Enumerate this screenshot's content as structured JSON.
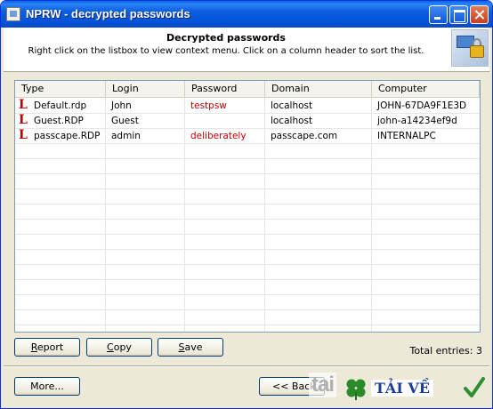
{
  "window": {
    "title": "NPRW - decrypted passwords"
  },
  "header": {
    "title": "Decrypted passwords",
    "subtitle": "Right click on the listbox to view context menu. Click on a column header to sort the list."
  },
  "table": {
    "columns": [
      "Type",
      "Login",
      "Password",
      "Domain",
      "Computer"
    ],
    "rows": [
      {
        "type": "Default.rdp",
        "login": "John",
        "password": "testpsw",
        "domain": "localhost",
        "computer": "JOHN-67DA9F1E3D"
      },
      {
        "type": "Guest.RDP",
        "login": "Guest",
        "password": "",
        "domain": "localhost",
        "computer": "john-a14234ef9d"
      },
      {
        "type": "passcape.RDP",
        "login": "admin",
        "password": "deliberately",
        "domain": "passcape.com",
        "computer": "INTERNALPC"
      }
    ],
    "row_icon": "L",
    "password_color": "#c00000"
  },
  "buttons": {
    "report": {
      "accel": "R",
      "rest": "eport"
    },
    "copy": {
      "accel": "C",
      "rest": "opy"
    },
    "save": {
      "accel": "S",
      "rest": "ave"
    },
    "more": "More...",
    "back": "<< Back"
  },
  "status": {
    "total_entries": "Total entries: 3"
  },
  "watermark": {
    "tai": "tai",
    "text": "TẢI VỀ"
  },
  "icons": {
    "app": "nprw-app-icon",
    "header_logo": "monitor-lock-icon",
    "file": "rdp-file-icon"
  }
}
